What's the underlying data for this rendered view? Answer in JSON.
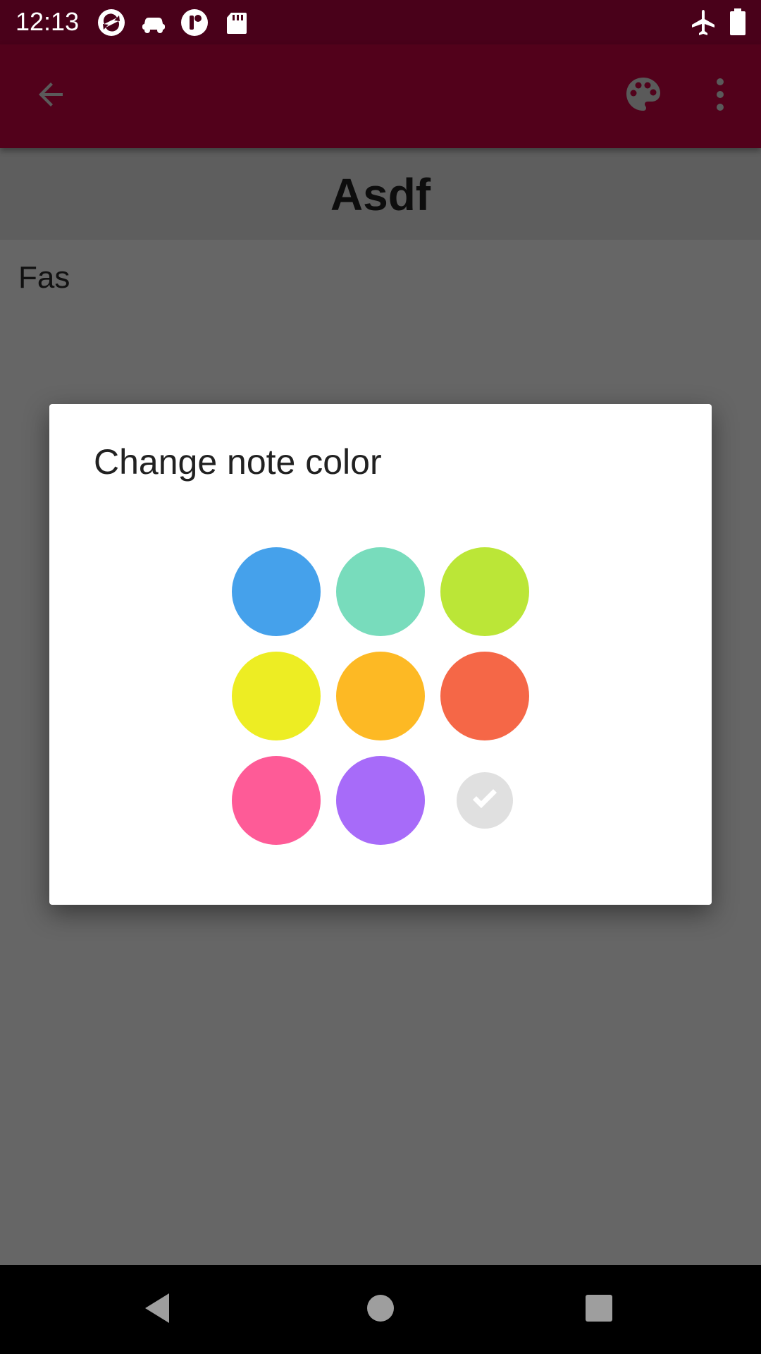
{
  "status_bar": {
    "time": "12:13",
    "icons": [
      "sync-icon",
      "car-icon",
      "timer-app-icon",
      "sd-card-icon",
      "airplane-mode-icon",
      "battery-icon"
    ]
  },
  "app_bar": {
    "back_icon": "arrow-back-icon",
    "palette_icon": "palette-icon",
    "menu_icon": "more-vert-icon",
    "background": "#52011b"
  },
  "note": {
    "title": "Asdf",
    "body": "Fas"
  },
  "dialog": {
    "title": "Change note color",
    "colors": [
      {
        "name": "blue",
        "hex": "#45a1eb"
      },
      {
        "name": "teal",
        "hex": "#78dcbc"
      },
      {
        "name": "lime",
        "hex": "#bbe637"
      },
      {
        "name": "yellow",
        "hex": "#eded23"
      },
      {
        "name": "amber",
        "hex": "#fdb924"
      },
      {
        "name": "orange",
        "hex": "#f56747"
      },
      {
        "name": "pink",
        "hex": "#fe5b97"
      },
      {
        "name": "purple",
        "hex": "#a76bf9"
      },
      {
        "name": "default-white",
        "hex": "#e0e0e0",
        "selected": true
      }
    ]
  },
  "nav_bar": {
    "icons": [
      "nav-back-icon",
      "nav-home-icon",
      "nav-recents-icon"
    ]
  }
}
